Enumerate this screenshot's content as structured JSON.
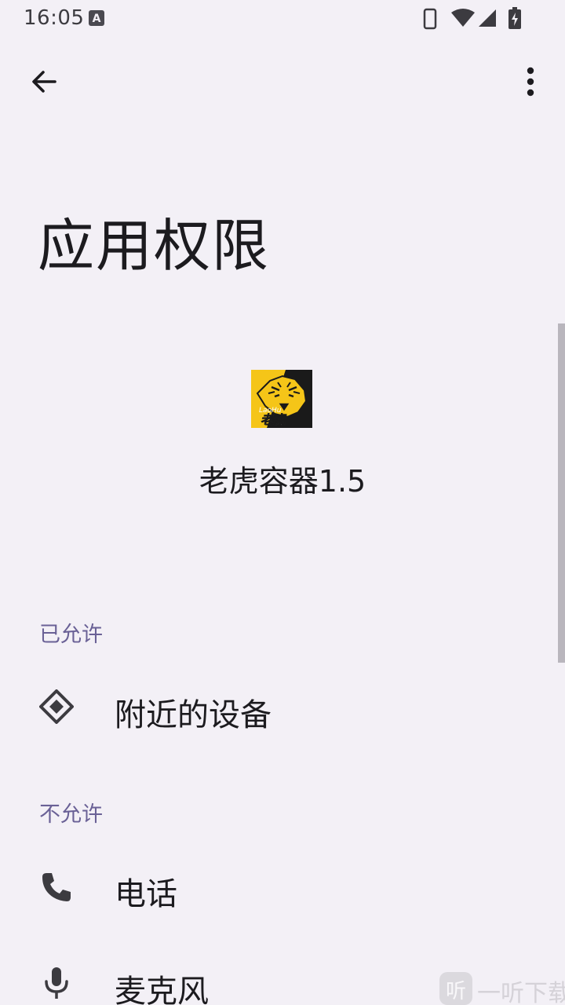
{
  "status_bar": {
    "time": "16:05",
    "notification_badge": "A"
  },
  "toolbar": {
    "back_icon": "arrow-back-icon",
    "more_icon": "more-vert-icon"
  },
  "page": {
    "title": "应用权限"
  },
  "app": {
    "name": "老虎容器1.5",
    "icon_text_top": "LaoHu",
    "icon_text_main": "老虎",
    "icon_colors": {
      "background": "#f5c518",
      "dark": "#1a1a1a"
    }
  },
  "sections": {
    "allowed": {
      "header": "已允许",
      "items": [
        {
          "label": "附近的设备",
          "icon": "nearby-devices-icon"
        }
      ]
    },
    "denied": {
      "header": "不允许",
      "items": [
        {
          "label": "电话",
          "icon": "phone-icon"
        },
        {
          "label": "麦克风",
          "icon": "microphone-icon"
        }
      ]
    }
  },
  "colors": {
    "background": "#f3f0f6",
    "section_header": "#6a6196",
    "text_primary": "#1c1b1f"
  },
  "watermark": {
    "logo_char": "听",
    "text": "一听下载"
  }
}
